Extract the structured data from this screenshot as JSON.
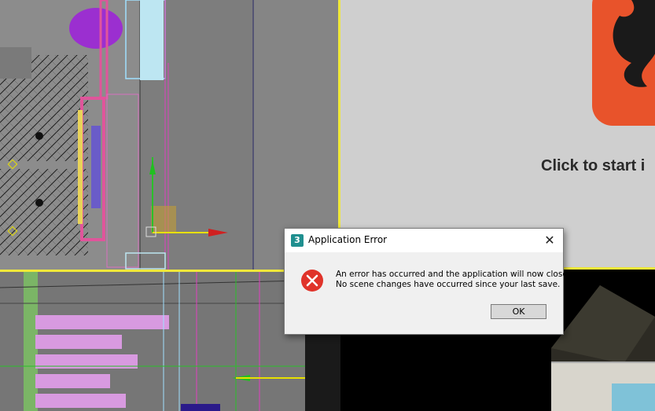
{
  "viewports": {
    "top_right": {
      "prompt_text": "Click to start i"
    }
  },
  "dialog": {
    "title": "Application Error",
    "app_icon_glyph": "3",
    "close_glyph": "✕",
    "message_line1": "An error has occurred and the application will now close.",
    "message_line2": "No scene changes have occurred since your last save.",
    "ok_label": "OK",
    "icon": "error-icon"
  },
  "colors": {
    "accent_viewport_border": "#f0e83a",
    "error_red": "#e0332a",
    "logo_orange": "#e8532b"
  }
}
